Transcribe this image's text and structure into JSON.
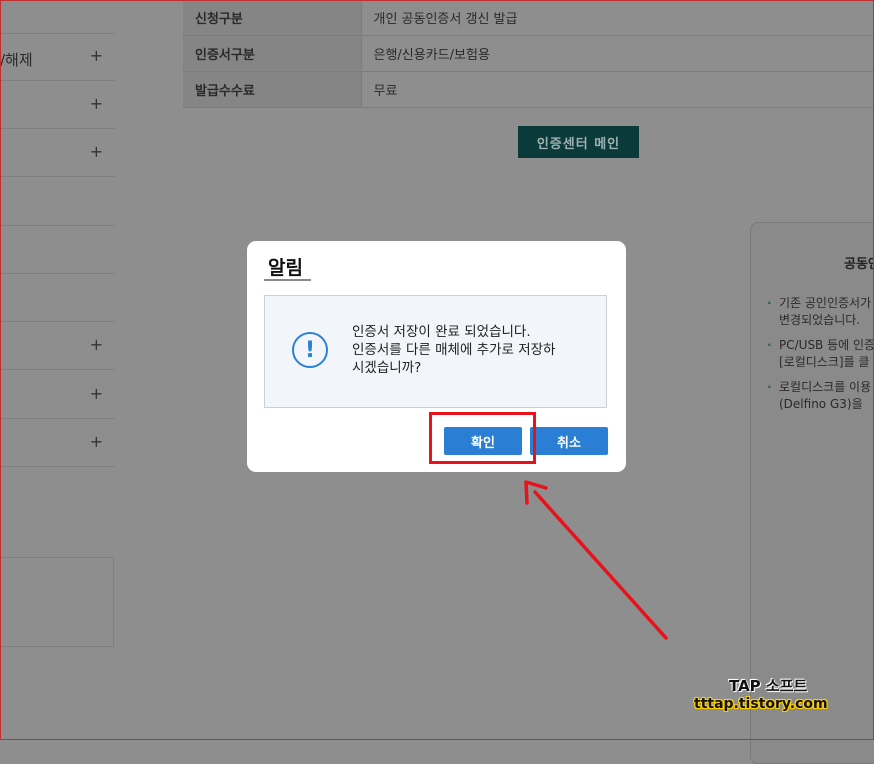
{
  "sidebar": {
    "items": [
      {
        "label": "/해제",
        "expandable": true
      },
      {
        "label": "",
        "expandable": true
      },
      {
        "label": "",
        "expandable": true
      },
      {
        "label": "",
        "expandable": false
      },
      {
        "label": "",
        "expandable": false
      },
      {
        "label": "",
        "expandable": false
      },
      {
        "label": "",
        "expandable": true
      },
      {
        "label": "",
        "expandable": true
      },
      {
        "label": "",
        "expandable": true
      }
    ],
    "plus_glyph": "+"
  },
  "info_table": {
    "rows": [
      {
        "header": "신청구분",
        "value": "개인 공동인증서 갱신 발급"
      },
      {
        "header": "인증서구분",
        "value": "은행/신용카드/보험용"
      },
      {
        "header": "발급수수료",
        "value": "무료"
      }
    ]
  },
  "main": {
    "main_button_label": "인증센터 메인"
  },
  "notice_panel": {
    "title": "공동인",
    "items": [
      {
        "line1": "기존 공인인증서가",
        "line2": "변경되었습니다."
      },
      {
        "line1": "PC/USB 등에 인증",
        "line2": "[로컬디스크]를 클"
      },
      {
        "line1": "로컬디스크를 이용",
        "line2": "(Delfino G3)을 "
      }
    ]
  },
  "modal": {
    "title": "알림",
    "icon_glyph": "!",
    "message_lines": [
      "인증서 저장이 완료 되었습니다.",
      "인증서를 다른 매체에 추가로 저장하",
      "시겠습니까?"
    ],
    "ok_label": "확인",
    "cancel_label": "취소",
    "accent_color": "#2a7ed3"
  },
  "annotation": {
    "highlight_color": "#e8121a"
  },
  "watermark": {
    "line1": "TAP 소프트",
    "line2": "tttap.tistory.com"
  }
}
